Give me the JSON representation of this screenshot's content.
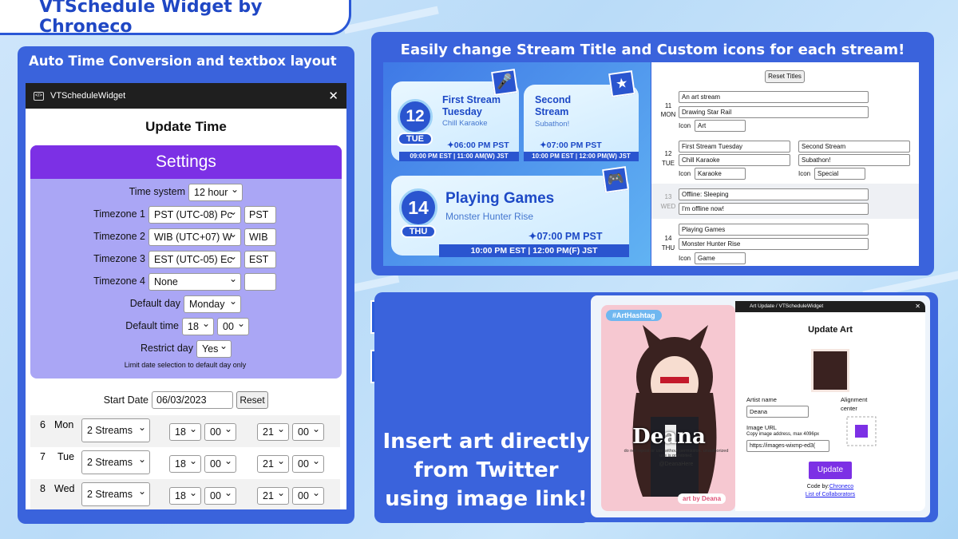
{
  "header": {
    "title": "VTSchedule Widget by Chroneco"
  },
  "left_panel": {
    "title": "Auto Time Conversion and textbox layout",
    "window_title": "VTScheduleWidget",
    "heading": "Update Time",
    "settings_title": "Settings",
    "time_system": {
      "label": "Time system",
      "value": "12 hour"
    },
    "timezones": [
      {
        "label": "Timezone 1",
        "value": "PST (UTC-08) Pc",
        "abbr": "PST"
      },
      {
        "label": "Timezone 2",
        "value": "WIB (UTC+07) W",
        "abbr": "WIB"
      },
      {
        "label": "Timezone 3",
        "value": "EST (UTC-05) Ec",
        "abbr": "EST"
      },
      {
        "label": "Timezone 4",
        "value": "None",
        "abbr": ""
      }
    ],
    "default_day": {
      "label": "Default day",
      "value": "Monday"
    },
    "default_time": {
      "label": "Default time",
      "hour": "18",
      "minute": "00"
    },
    "restrict_day": {
      "label": "Restrict day",
      "value": "Yes",
      "note": "Limit date selection to default day only"
    },
    "start_date": {
      "label": "Start Date",
      "value": "06/03/2023",
      "button": "Reset"
    },
    "days": [
      {
        "num": "6",
        "day": "Mon",
        "streams": "2 Streams",
        "h1": "18",
        "m1": "00",
        "h2": "21",
        "m2": "00"
      },
      {
        "num": "7",
        "day": "Tue",
        "streams": "2 Streams",
        "h1": "18",
        "m1": "00",
        "h2": "21",
        "m2": "00"
      },
      {
        "num": "8",
        "day": "Wed",
        "streams": "2 Streams",
        "h1": "18",
        "m1": "00",
        "h2": "21",
        "m2": "00"
      }
    ]
  },
  "right_panel": {
    "title": "Easily change Stream Title and Custom icons for each stream!",
    "cards": [
      {
        "date": "12",
        "day": "TUE",
        "title": "First Stream Tuesday",
        "title_l1": "First Stream",
        "title_l2": "Tuesday",
        "sub": "Chill Karaoke",
        "time": "✦06:00 PM PST",
        "bar": "09:00 PM EST  |  11:00 AM(W) JST"
      },
      {
        "title_l1": "Second",
        "title_l2": "Stream",
        "sub": "Subathon!",
        "time": "✦07:00 PM PST",
        "bar": "10:00 PM EST  |  12:00 PM(W) JST"
      },
      {
        "date": "14",
        "day": "THU",
        "title": "Playing Games",
        "sub": "Monster Hunter Rise",
        "time": "✦07:00 PM PST",
        "bar": "10:00 PM EST   |   12:00 PM(F) JST"
      }
    ],
    "editor": {
      "reset": "Reset Titles",
      "icon_label": "Icon",
      "rows": [
        {
          "num": "11",
          "day": "MON",
          "title": "An art stream",
          "sub": "Drawing Star Rail",
          "icon": "Art"
        },
        {
          "num": "12",
          "day": "TUE",
          "title": "First Stream Tuesday",
          "sub": "Chill Karaoke",
          "icon": "Karaoke",
          "title2": "Second Stream",
          "sub2": "Subathon!",
          "icon2": "Special"
        },
        {
          "num": "13",
          "day": "WED",
          "title": "Offline: Sleeping",
          "sub": "I'm offline now!"
        },
        {
          "num": "14",
          "day": "THU",
          "title": "Playing Games",
          "sub": "Monster Hunter Rise",
          "icon": "Game"
        }
      ]
    }
  },
  "icons": [
    "star-icon",
    "microphone-icon",
    "chat-icon",
    "gamepad-icon",
    "palette-icon",
    "monitor-icon",
    "podcast-mic-icon",
    "people-icon"
  ],
  "bottom_panel": {
    "insert_text": [
      "Insert art directly",
      "from Twitter",
      "using image link!"
    ],
    "art": {
      "hashtag": "#ArtHashtag",
      "name": "Deana",
      "credit": "art by Deana",
      "handle": "@DeanaHere",
      "disclaimer": "do not repost or use without permission. unauthorized use is prohibited."
    },
    "window": {
      "title": "Art Update / VTScheduleWidget",
      "heading": "Update Art",
      "artist_label": "Artist name",
      "artist_value": "Deana",
      "align_label": "Alignment",
      "align_value": "center",
      "url_label": "Image URL",
      "url_note": "Copy image address, max 4096px",
      "url_value": "https://images-wixmp-ed3(",
      "update": "Update",
      "code_by": "Code by:",
      "author": "Chroneco",
      "collab": "List of Collaborators"
    }
  },
  "colors": {
    "panel": "#3a63dc",
    "accent": "#7c30e5",
    "settings_bg": "#aaa6f5",
    "brand": "#1f47c4"
  }
}
